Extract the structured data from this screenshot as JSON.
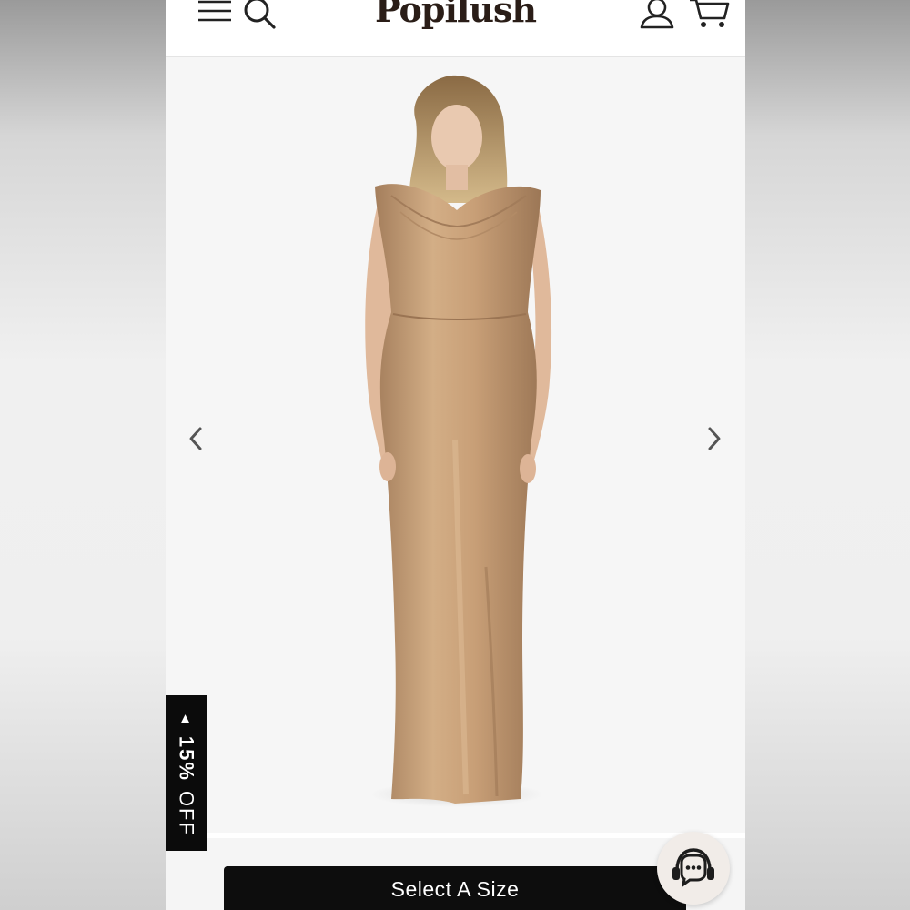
{
  "header": {
    "logo": "Popilush",
    "icons": [
      "menu-icon",
      "search-icon",
      "account-icon",
      "cart-icon"
    ]
  },
  "gallery": {
    "subject": "model wearing champagne gold cowl-neck maxi dress",
    "prev_icon": "chevron-left-icon",
    "next_icon": "chevron-right-icon"
  },
  "promo": {
    "arrow": "▲",
    "percent": "15%",
    "off": "OFF"
  },
  "actions": {
    "select_size": "Select A Size",
    "chat_icon": "headset-chat-icon"
  },
  "colors": {
    "dress": "#c9a27a",
    "button_bg": "#0d0d0d",
    "logo": "#2a1d17"
  }
}
